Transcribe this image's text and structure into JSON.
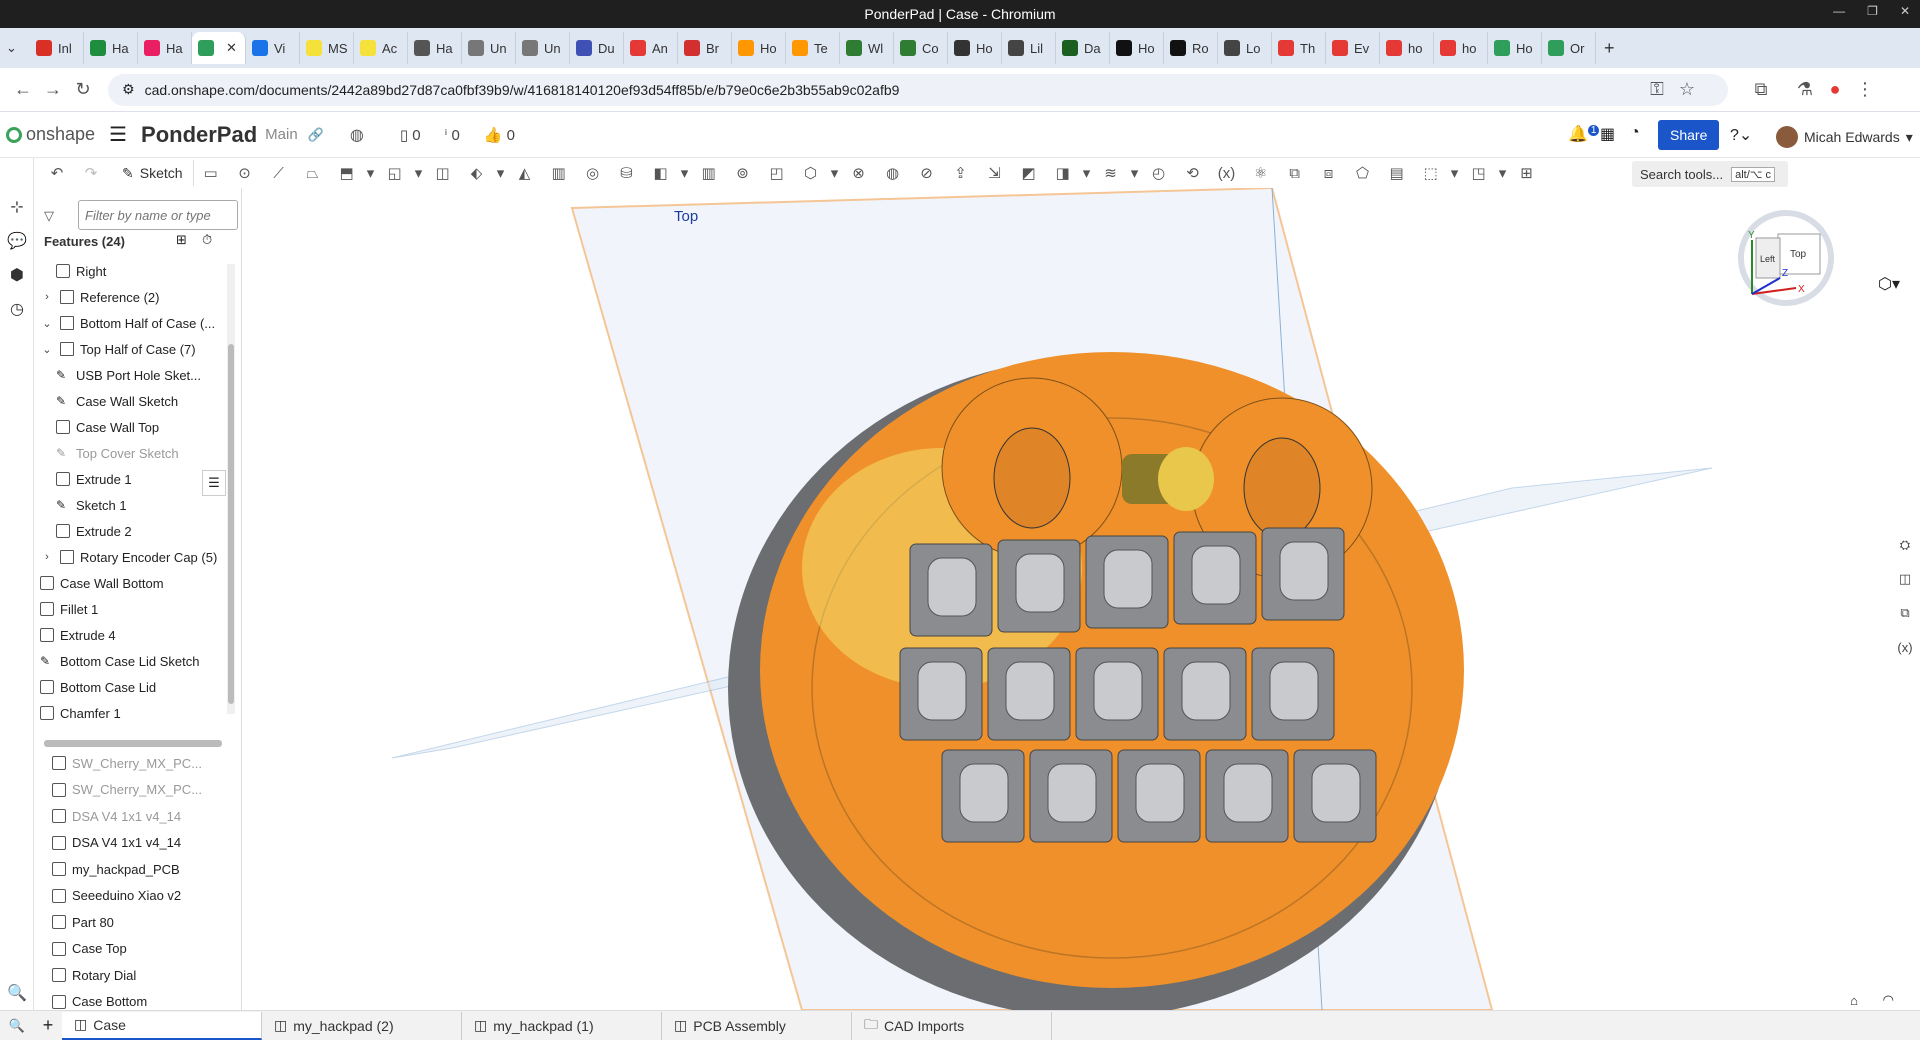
{
  "window": {
    "title": "PonderPad | Case - Chromium"
  },
  "browser_tabs": [
    {
      "label": "Inl",
      "color": "#d93025"
    },
    {
      "label": "Ha",
      "color": "#1e8e3e"
    },
    {
      "label": "Ha",
      "color": "#e91e63"
    },
    {
      "label": "",
      "color": "#2e9e5a",
      "active": true
    },
    {
      "label": "Vi",
      "color": "#1a73e8"
    },
    {
      "label": "MS",
      "color": "#f4e23b"
    },
    {
      "label": "Ac",
      "color": "#f4e23b"
    },
    {
      "label": "Ha",
      "color": "#555"
    },
    {
      "label": "Un",
      "color": "#777"
    },
    {
      "label": "Un",
      "color": "#777"
    },
    {
      "label": "Du",
      "color": "#3f51b5"
    },
    {
      "label": "An",
      "color": "#e53935"
    },
    {
      "label": "Br",
      "color": "#d32f2f"
    },
    {
      "label": "Ho",
      "color": "#ff9800"
    },
    {
      "label": "Te",
      "color": "#ff9800"
    },
    {
      "label": "Wl",
      "color": "#2e7d32"
    },
    {
      "label": "Co",
      "color": "#2e7d32"
    },
    {
      "label": "Ho",
      "color": "#333"
    },
    {
      "label": "Lil",
      "color": "#444"
    },
    {
      "label": "Da",
      "color": "#1b5e20"
    },
    {
      "label": "Ho",
      "color": "#111"
    },
    {
      "label": "Ro",
      "color": "#111"
    },
    {
      "label": "Lo",
      "color": "#444"
    },
    {
      "label": "Th",
      "color": "#e53935"
    },
    {
      "label": "Ev",
      "color": "#e53935"
    },
    {
      "label": "ho",
      "color": "#e53935"
    },
    {
      "label": "ho",
      "color": "#e53935"
    },
    {
      "label": "Ho",
      "color": "#2e9e5a"
    },
    {
      "label": "Or",
      "color": "#2e9e5a"
    }
  ],
  "address": {
    "url": "cad.onshape.com/documents/2442a89bd27d87ca0fbf39b9/w/416818140120ef93d54ff85b/e/b79e0c6e2b3b55ab9c02afb9"
  },
  "app": {
    "brand": "onshape",
    "document": "PonderPad",
    "branch": "Main",
    "count_versions": "0",
    "count_info": "0",
    "count_likes": "0",
    "notifications": "1",
    "share": "Share",
    "user": "Micah Edwards"
  },
  "toolbar": {
    "sketch_label": "Sketch",
    "search_label": "Search tools...",
    "search_shortcut": "alt/⌥ c"
  },
  "panel": {
    "filter_placeholder": "Filter by name or type",
    "features_header": "Features (24)",
    "features": [
      {
        "label": "Right",
        "indent": 1,
        "kind": "plane"
      },
      {
        "label": "Reference (2)",
        "indent": 0,
        "kind": "folder",
        "chev": "›"
      },
      {
        "label": "Bottom Half of Case (...",
        "indent": 0,
        "kind": "folder",
        "chev": "⌄"
      },
      {
        "label": "Top Half of Case (7)",
        "indent": 0,
        "kind": "folder",
        "chev": "⌄"
      },
      {
        "label": "USB Port Hole Sket...",
        "indent": 1,
        "kind": "sketch"
      },
      {
        "label": "Case Wall Sketch",
        "indent": 1,
        "kind": "sketch"
      },
      {
        "label": "Case Wall Top",
        "indent": 1,
        "kind": "feature"
      },
      {
        "label": "Top Cover Sketch",
        "indent": 1,
        "kind": "sketch",
        "dim": true
      },
      {
        "label": "Extrude 1",
        "indent": 1,
        "kind": "feature"
      },
      {
        "label": "Sketch 1",
        "indent": 1,
        "kind": "sketch"
      },
      {
        "label": "Extrude 2",
        "indent": 1,
        "kind": "feature"
      },
      {
        "label": "Rotary Encoder Cap (5)",
        "indent": 0,
        "kind": "folder",
        "chev": "›"
      },
      {
        "label": "Case Wall Bottom",
        "indent": -1,
        "kind": "feature"
      },
      {
        "label": "Fillet 1",
        "indent": -1,
        "kind": "feature"
      },
      {
        "label": "Extrude 4",
        "indent": -1,
        "kind": "feature"
      },
      {
        "label": "Bottom Case Lid Sketch",
        "indent": -1,
        "kind": "sketch"
      },
      {
        "label": "Bottom Case Lid",
        "indent": -1,
        "kind": "feature"
      },
      {
        "label": "Chamfer 1",
        "indent": -1,
        "kind": "feature"
      }
    ],
    "parts": [
      {
        "label": "SW_Cherry_MX_PC...",
        "dim": true
      },
      {
        "label": "SW_Cherry_MX_PC...",
        "dim": true
      },
      {
        "label": "DSA V4 1x1 v4_14",
        "dim": true
      },
      {
        "label": "DSA V4 1x1 v4_14",
        "dim": false
      },
      {
        "label": "my_hackpad_PCB",
        "dim": false
      },
      {
        "label": "Seeeduino Xiao v2",
        "dim": false
      },
      {
        "label": "Part 80",
        "dim": false
      },
      {
        "label": "Case Top",
        "dim": false
      },
      {
        "label": "Rotary Dial",
        "dim": false
      },
      {
        "label": "Case Bottom",
        "dim": false
      }
    ]
  },
  "viewport": {
    "plane_label": "Top",
    "cube_top": "Top",
    "cube_left": "Left",
    "axis_x": "X",
    "axis_y": "Y",
    "axis_z": "Z",
    "case_color": "#f0902a",
    "key_color": "#8a8c90"
  },
  "bottom_tabs": [
    {
      "label": "Case",
      "active": true
    },
    {
      "label": "my_hackpad (2)"
    },
    {
      "label": "my_hackpad (1)"
    },
    {
      "label": "PCB Assembly"
    },
    {
      "label": "CAD Imports"
    }
  ]
}
